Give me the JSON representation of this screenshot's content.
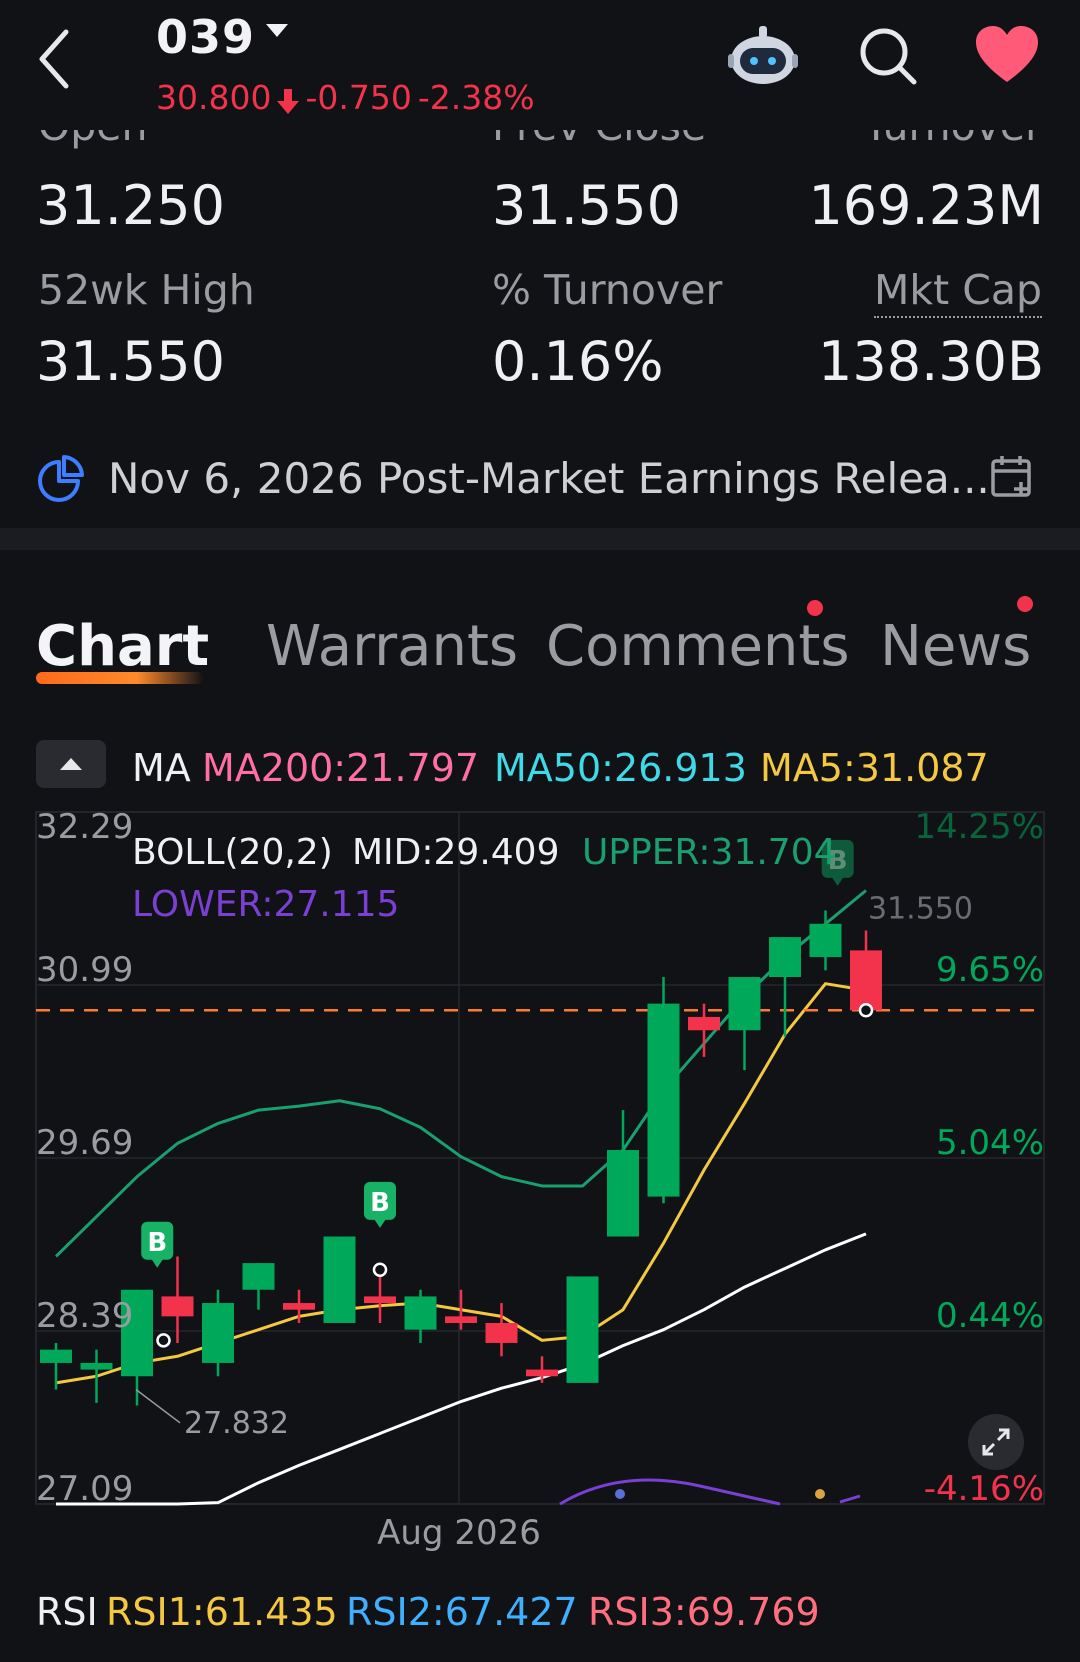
{
  "header": {
    "ticker": "039",
    "price": "30.800",
    "change": "-0.750",
    "change_pct": "-2.38%"
  },
  "stats": {
    "open_label": "Open",
    "open_value": "31.250",
    "prev_close_label": "Prev Close",
    "prev_close_value": "31.550",
    "turnover_label": "Turnover",
    "turnover_value": "169.23M",
    "high52_label": "52wk High",
    "high52_value": "31.550",
    "pct_turnover_label": "% Turnover",
    "pct_turnover_value": "0.16%",
    "mktcap_label": "Mkt Cap",
    "mktcap_value": "138.30B"
  },
  "earnings": {
    "text": "Nov 6, 2026 Post-Market Earnings Relea..."
  },
  "tabs": [
    {
      "label": "Chart"
    },
    {
      "label": "Warrants"
    },
    {
      "label": "Comments"
    },
    {
      "label": "News"
    }
  ],
  "indicators": {
    "ma_label": "MA",
    "ma200": "MA200:21.797",
    "ma50": "MA50:26.913",
    "ma5": "MA5:31.087",
    "boll_label": "BOLL(20,2)",
    "boll_mid": "MID:29.409",
    "boll_upper": "UPPER:31.704",
    "boll_lower": "LOWER:27.115"
  },
  "chart_data": {
    "type": "candlestick",
    "y_ticks": [
      "32.29",
      "30.99",
      "29.69",
      "28.39",
      "27.09"
    ],
    "pct_ticks": [
      "14.25%",
      "9.65%",
      "5.04%",
      "0.44%",
      "-4.16%"
    ],
    "x_label": "Aug 2026",
    "ylim": [
      27.09,
      32.29
    ],
    "high_label": "31.550",
    "low_label": "27.832",
    "last_price_line": 30.8,
    "candles": [
      {
        "o": 28.15,
        "h": 28.3,
        "l": 27.95,
        "c": 28.25
      },
      {
        "o": 28.1,
        "h": 28.25,
        "l": 27.85,
        "c": 28.15
      },
      {
        "o": 28.05,
        "h": 28.7,
        "l": 27.83,
        "c": 28.7
      },
      {
        "o": 28.65,
        "h": 28.95,
        "l": 28.3,
        "c": 28.5
      },
      {
        "o": 28.15,
        "h": 28.7,
        "l": 28.05,
        "c": 28.6
      },
      {
        "o": 28.7,
        "h": 28.9,
        "l": 28.55,
        "c": 28.9
      },
      {
        "o": 28.6,
        "h": 28.7,
        "l": 28.45,
        "c": 28.55
      },
      {
        "o": 28.45,
        "h": 29.1,
        "l": 28.45,
        "c": 29.1
      },
      {
        "o": 28.65,
        "h": 28.8,
        "l": 28.45,
        "c": 28.6
      },
      {
        "o": 28.4,
        "h": 28.7,
        "l": 28.3,
        "c": 28.65
      },
      {
        "o": 28.5,
        "h": 28.7,
        "l": 28.4,
        "c": 28.45
      },
      {
        "o": 28.45,
        "h": 28.6,
        "l": 28.2,
        "c": 28.3
      },
      {
        "o": 28.1,
        "h": 28.2,
        "l": 28.0,
        "c": 28.05
      },
      {
        "o": 28.0,
        "h": 28.8,
        "l": 28.0,
        "c": 28.8
      },
      {
        "o": 29.1,
        "h": 30.05,
        "l": 29.1,
        "c": 29.75
      },
      {
        "o": 29.4,
        "h": 31.05,
        "l": 29.35,
        "c": 30.85
      },
      {
        "o": 30.75,
        "h": 30.85,
        "l": 30.45,
        "c": 30.65
      },
      {
        "o": 30.65,
        "h": 31.05,
        "l": 30.35,
        "c": 31.05
      },
      {
        "o": 31.05,
        "h": 31.35,
        "l": 30.6,
        "c": 31.35
      },
      {
        "o": 31.2,
        "h": 31.55,
        "l": 31.1,
        "c": 31.45
      },
      {
        "o": 31.25,
        "h": 31.4,
        "l": 30.8,
        "c": 30.8
      }
    ],
    "series": [
      {
        "values": [
          28.0,
          28.05,
          28.15,
          28.2,
          28.3,
          28.4,
          28.5,
          28.55,
          28.58,
          28.6,
          28.55,
          28.5,
          28.32,
          28.35,
          28.55,
          29.05,
          29.6,
          30.1,
          30.62,
          31.0,
          30.95
        ]
      },
      {
        "values": [
          26.6,
          26.72,
          26.85,
          26.98,
          27.1,
          27.25,
          27.38,
          27.5,
          27.62,
          27.74,
          27.86,
          27.96,
          28.04,
          28.14,
          28.28,
          28.4,
          28.55,
          28.72,
          28.86,
          29.0,
          29.12
        ]
      },
      {
        "values": [
          28.95,
          29.25,
          29.55,
          29.8,
          29.95,
          30.05,
          30.08,
          30.12,
          30.06,
          29.92,
          29.7,
          29.55,
          29.48,
          29.48,
          29.75,
          30.2,
          30.55,
          30.9,
          31.2,
          31.45,
          31.7
        ]
      }
    ],
    "markers": [
      "B",
      "B",
      "B"
    ]
  },
  "rsi": {
    "label": "RSI",
    "rsi1": "RSI1:61.435",
    "rsi2": "RSI2:67.427",
    "rsi3": "RSI3:69.769"
  },
  "colors": {
    "up": "#00a85a",
    "down": "#f2334b",
    "ma5": "#f5c842",
    "ma50": "#ffffff",
    "boll_upper": "#1a9f6e",
    "boll_lower": "#7b3fd3",
    "ma200_text": "#ff6fa3",
    "ma50_text": "#3fd9e8"
  }
}
